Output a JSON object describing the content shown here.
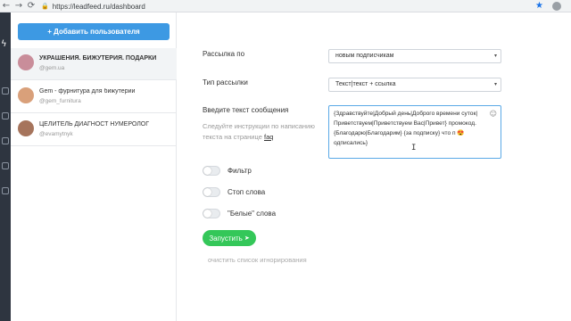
{
  "browser": {
    "back": "←",
    "forward": "→",
    "reload": "⟳",
    "url": "https://leadfeed.ru/dashboard",
    "star": "★"
  },
  "sidebar": {
    "add_button": "+ Добавить пользователя",
    "users": [
      {
        "name": "УКРАШЕНИЯ. БИЖУТЕРИЯ. ПОДАРКИ",
        "handle": "@gem.ua",
        "avatar_color": "#c98d9a"
      },
      {
        "name": "Gem - фурнитура для бижутерии",
        "handle": "@gem_furnitura",
        "avatar_color": "#d9a07a"
      },
      {
        "name": "ЦЕЛИТЕЛЬ ДИАГНОСТ НУМЕРОЛОГ",
        "handle": "@evamytnyk",
        "avatar_color": "#a6745c"
      }
    ]
  },
  "form": {
    "mailing_label": "Рассылка по",
    "mailing_value": "новым подписчикам",
    "type_label": "Тип рассылки",
    "type_value": "Текст|текст + ссылка",
    "message_label": "Введите текст сообщения",
    "hint_text": "Следуйте инструкции по написанию текста на странице",
    "hint_link": "faq",
    "message_text": "{Здравствуйте|Добрый день|Доброго времени суток|Приветствуем|Приветствуем Вас|Привет} промокод. {Благодарю|Благодарим} {за подписку} что п 😍 одписались}",
    "caret": "▾",
    "emoji_icon": "☺"
  },
  "toggles": [
    {
      "label": "Фильтр",
      "on": false
    },
    {
      "label": "Стоп слова",
      "on": false
    },
    {
      "label": "\"Белые\" слова",
      "on": false
    }
  ],
  "actions": {
    "run_label": "Запустить",
    "run_icon": "➤",
    "clear_label": "очистить список игнорирования"
  },
  "colors": {
    "primary": "#3d99e3",
    "success": "#34c759",
    "rail": "#2e3540"
  }
}
